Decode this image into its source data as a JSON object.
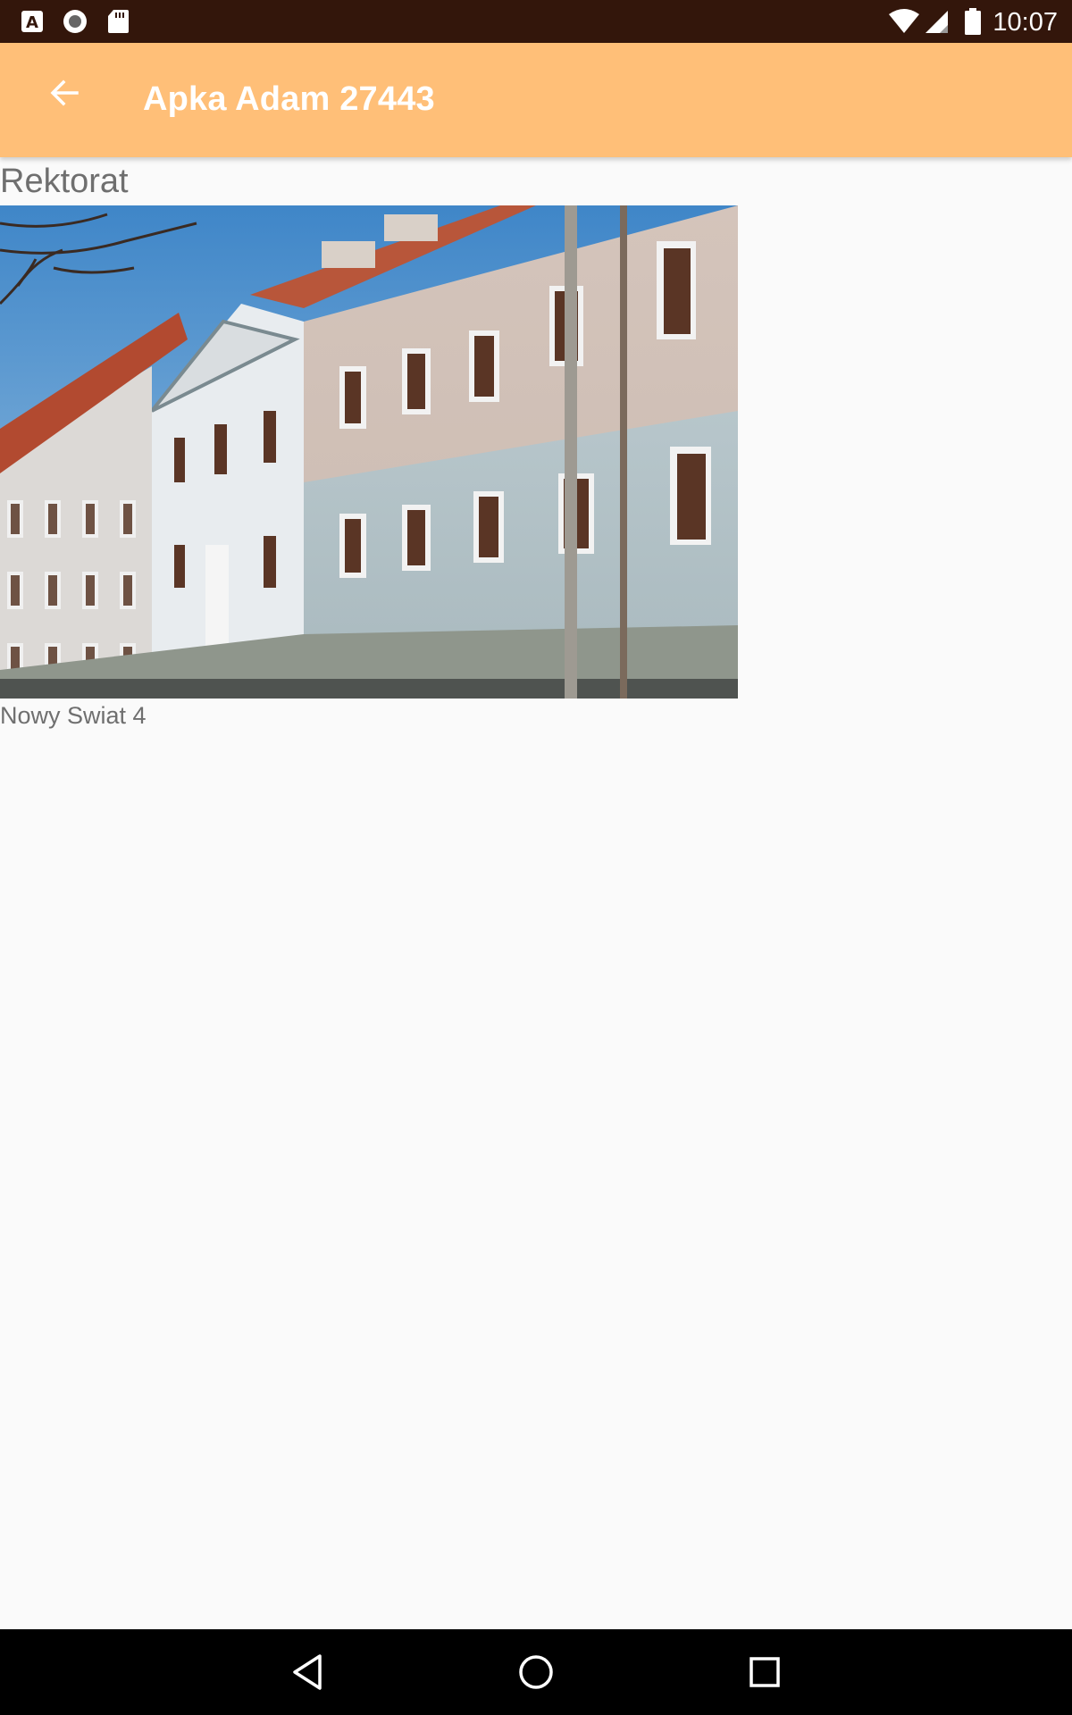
{
  "status_bar": {
    "time": "10:07",
    "left_icons": [
      "font-a-icon",
      "circle-record-icon",
      "sd-card-icon"
    ],
    "right_icons": [
      "wifi-icon",
      "cell-signal-icon",
      "battery-icon"
    ]
  },
  "app_bar": {
    "title": "Apka Adam 27443",
    "back_icon": "arrow-back-icon",
    "color": "#ffbf78"
  },
  "place": {
    "title": "Rektorat",
    "address": "Nowy Swiat 4",
    "photo": "building-facade-photo"
  },
  "nav_bar": {
    "icons": [
      "back-triangle-icon",
      "home-circle-icon",
      "recents-square-icon"
    ]
  }
}
